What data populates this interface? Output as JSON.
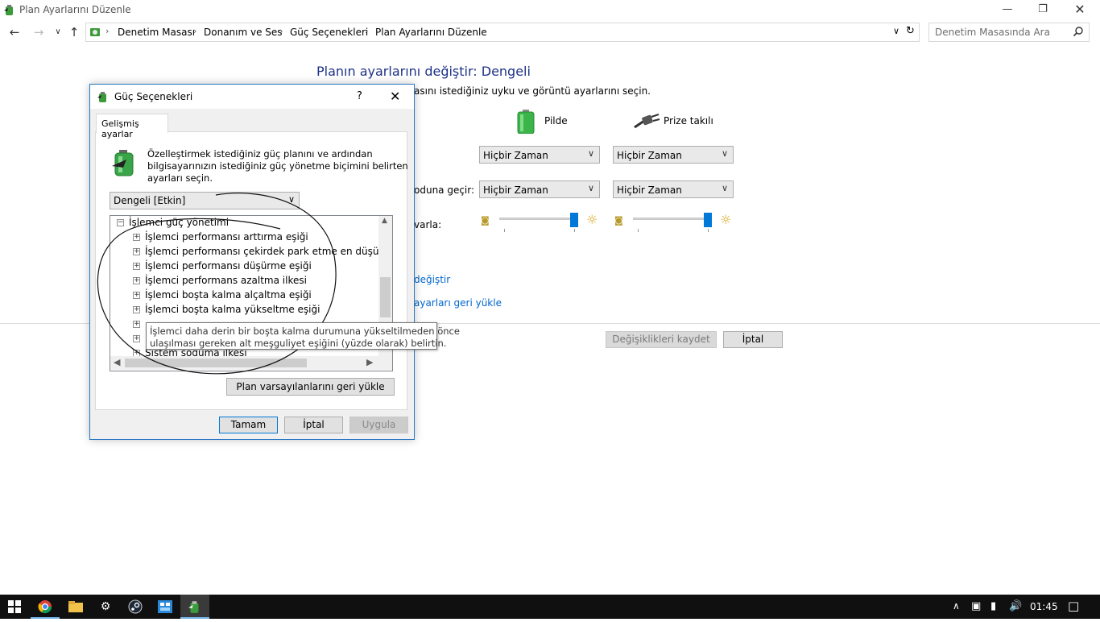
{
  "window": {
    "title": "Plan Ayarlarını Düzenle"
  },
  "addressbar": {
    "breadcrumbs": [
      "Denetim Masası",
      "Donanım ve Ses",
      "Güç Seçenekleri",
      "Plan Ayarlarını Düzenle"
    ]
  },
  "search": {
    "placeholder": "Denetim Masasında Ara"
  },
  "plan": {
    "heading": "Planın ayarlarını değiştir: Dengeli",
    "subtitle_visible": "asını istediğiniz uyku ve görüntü ayarlarını seçin.",
    "col_battery": "Pilde",
    "col_plugged": "Prize takılı",
    "row2_label_visible": "oduna geçir:",
    "row3_label_visible": "varla:",
    "display_off_battery": "Hiçbir Zaman",
    "display_off_plugged": "Hiçbir Zaman",
    "sleep_battery": "Hiçbir Zaman",
    "sleep_plugged": "Hiçbir Zaman",
    "link1_visible": "değiştir",
    "link2_visible": "ayarları geri yükle",
    "save_label": "Değişiklikleri kaydet",
    "cancel_label": "İptal"
  },
  "dialog": {
    "title": "Güç Seçenekleri",
    "help": "?",
    "tab": "Gelişmiş ayarlar",
    "description": [
      "Özelleştirmek istediğiniz güç planını ve ardından",
      "bilgisayarınızın istediğiniz güç yönetme biçimini belirten",
      "ayarları seçin."
    ],
    "plan_select": "Dengeli [Etkin]",
    "tree": {
      "parent": "İşlemci güç yönetimi",
      "items": [
        "İşlemci performansı arttırma eşiği",
        "İşlemci performansı çekirdek park etme en düşük çekirdekleri",
        "İşlemci performansı düşürme eşiği",
        "İşlemci performans azaltma ilkesi",
        "İşlemci boşta kalma alçaltma eşiği",
        "İşlemci boşta kalma yükseltme eşiği",
        "",
        "",
        "Sistem soğuma ilkesi"
      ]
    },
    "tooltip": [
      "İşlemci daha derin bir boşta kalma durumuna yükseltilmeden önce",
      "ulaşılması gereken alt meşguliyet eşiğini (yüzde olarak) belirtin."
    ],
    "restore_label": "Plan varsayılanlarını geri yükle",
    "ok_label": "Tamam",
    "cancel_label": "İptal",
    "apply_label": "Uygula"
  },
  "taskbar": {
    "clock": "01:45"
  },
  "colors": {
    "accent": "#0078d7",
    "heading": "#1e3287",
    "link": "#0066cc",
    "taskbar": "#101010"
  }
}
